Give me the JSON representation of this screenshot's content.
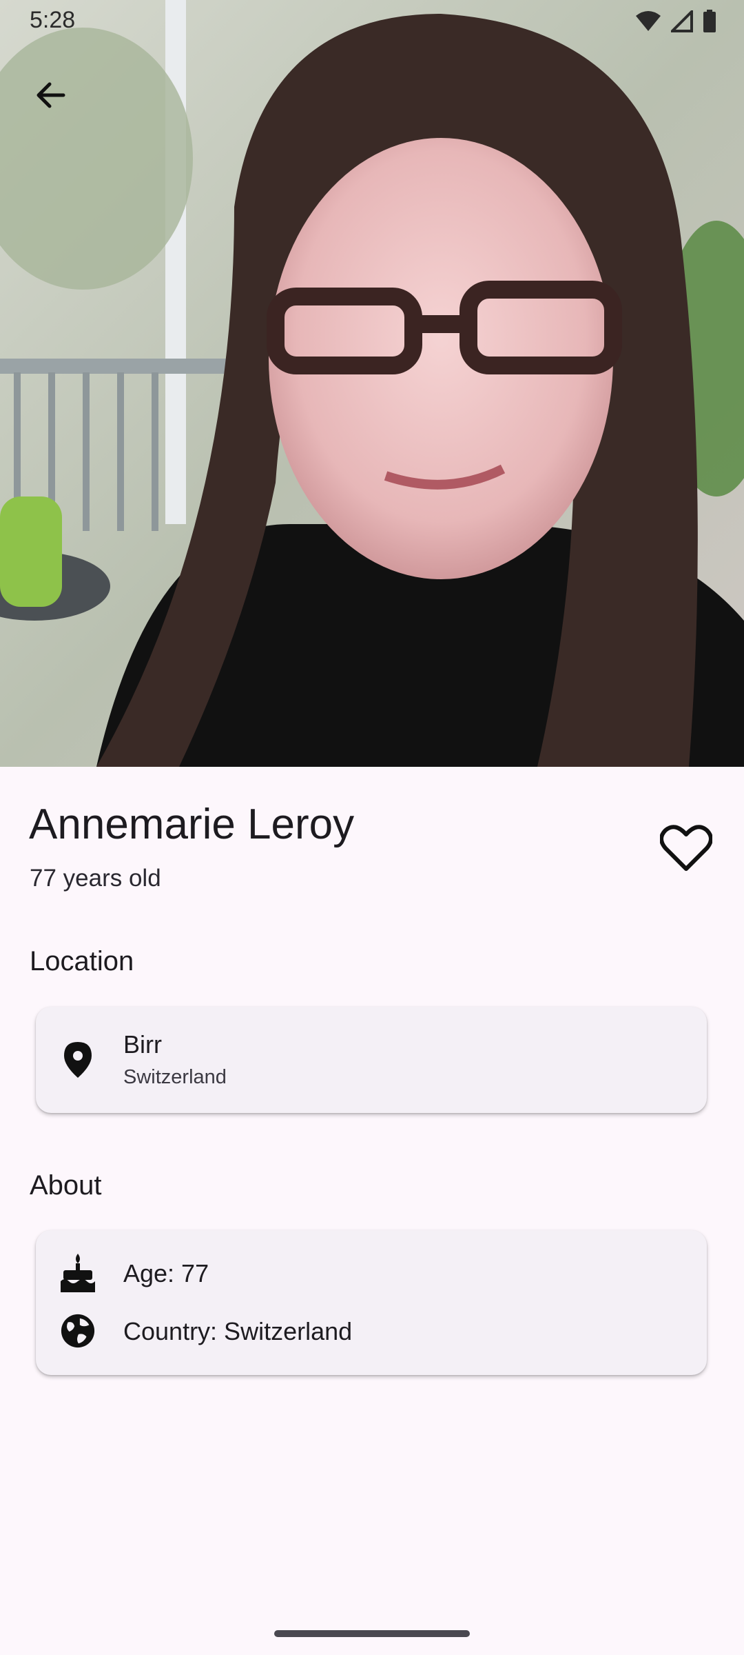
{
  "status_bar": {
    "time": "5:28",
    "icons": [
      "wifi-icon",
      "cell-signal-icon",
      "battery-icon"
    ]
  },
  "header": {
    "back_icon": "arrow-back-icon"
  },
  "profile": {
    "name": "Annemarie Leroy",
    "age_text": "77 years old",
    "favorite_icon": "heart-outline-icon"
  },
  "location": {
    "title": "Location",
    "icon": "location-pin-icon",
    "city": "Birr",
    "country": "Switzerland"
  },
  "about": {
    "title": "About",
    "items": [
      {
        "icon": "cake-icon",
        "text": "Age: 77"
      },
      {
        "icon": "globe-icon",
        "text": "Country: Switzerland"
      }
    ]
  },
  "colors": {
    "background": "#fdf7fc",
    "card": "#f4f0f6",
    "text": "#1d1b20"
  }
}
